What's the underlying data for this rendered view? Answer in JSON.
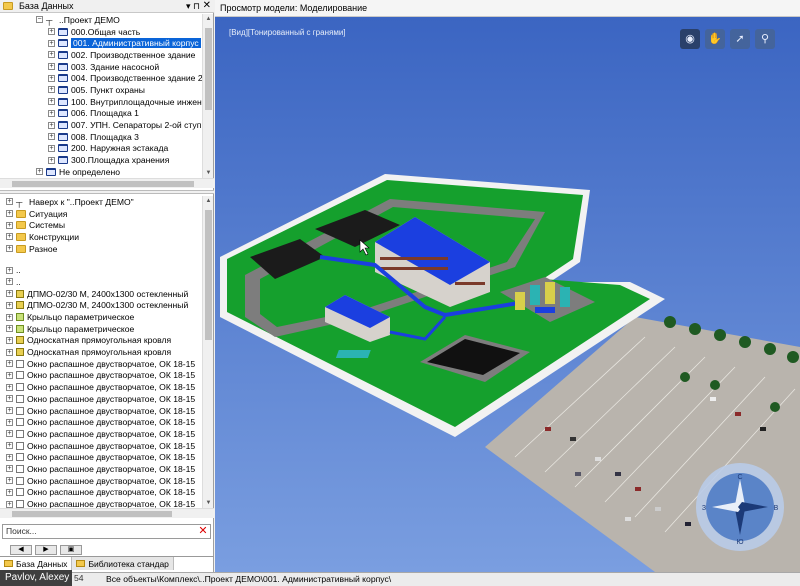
{
  "left_panel": {
    "title": "База Данных",
    "pin": "▾ ⊓",
    "close": "✕"
  },
  "top_tree": {
    "root": "..Проект ДЕМО",
    "items": [
      "000.Общая часть",
      "001. Административный корпус",
      "002. Производственное здание",
      "003. Здание насосной",
      "004. Производственное здание 2",
      "005. Пункт охраны",
      "100. Внутриплощадочные инжен",
      "006. Площадка 1",
      "007. УПН. Сепараторы 2-ой ступ",
      "008. Площадка 3",
      "200. Наружная эстакада",
      "300.Площадка хранения"
    ],
    "last": "Не определено"
  },
  "bottom_tree": {
    "up": "Наверх к \"..Проект ДЕМО\"",
    "folders": [
      "Ситуация",
      "Системы",
      "Конструкции",
      "Разное"
    ],
    "blank_rows": [
      "..",
      ".."
    ],
    "elements": [
      {
        "label": "ДПМО-02/30 М, 2400x1300 остекленный",
        "icon": "comp"
      },
      {
        "label": "ДПМО-02/30 М, 2400x1300 остекленный",
        "icon": "comp"
      },
      {
        "label": "Крыльцо параметрическое",
        "icon": "grn"
      },
      {
        "label": "Крыльцо параметрическое",
        "icon": "grn"
      },
      {
        "label": "Односкатная прямоугольная кровля",
        "icon": "comp"
      },
      {
        "label": "Односкатная прямоугольная кровля",
        "icon": "comp"
      },
      {
        "label": "Окно распашное двустворчатое, ОК 18-15",
        "icon": "win"
      },
      {
        "label": "Окно распашное двустворчатое, ОК 18-15",
        "icon": "win"
      },
      {
        "label": "Окно распашное двустворчатое, ОК 18-15",
        "icon": "win"
      },
      {
        "label": "Окно распашное двустворчатое, ОК 18-15",
        "icon": "win"
      },
      {
        "label": "Окно распашное двустворчатое, ОК 18-15",
        "icon": "win"
      },
      {
        "label": "Окно распашное двустворчатое, ОК 18-15",
        "icon": "win"
      },
      {
        "label": "Окно распашное двустворчатое, ОК 18-15",
        "icon": "win"
      },
      {
        "label": "Окно распашное двустворчатое, ОК 18-15",
        "icon": "win"
      },
      {
        "label": "Окно распашное двустворчатое, ОК 18-15",
        "icon": "win"
      },
      {
        "label": "Окно распашное двустворчатое, ОК 18-15",
        "icon": "win"
      },
      {
        "label": "Окно распашное двустворчатое, ОК 18-15",
        "icon": "win"
      },
      {
        "label": "Окно распашное двустворчатое, ОК 18-15",
        "icon": "win"
      },
      {
        "label": "Окно распашное двустворчатое, ОК 18-15",
        "icon": "win"
      }
    ]
  },
  "search": {
    "placeholder": "Поиск..."
  },
  "tabs": [
    {
      "label": "База Данных",
      "active": true
    },
    {
      "label": "Библиотека стандар",
      "active": false
    }
  ],
  "viewport": {
    "title": "Просмотр модели: Моделирование",
    "mode": "[Вид][Тонированный с гранями]",
    "tools": [
      {
        "name": "eye-icon",
        "glyph": "◉"
      },
      {
        "name": "hand-icon",
        "glyph": "✋"
      },
      {
        "name": "fly-icon",
        "glyph": "➚"
      },
      {
        "name": "walk-icon",
        "glyph": "⚲"
      }
    ],
    "compass_letters": [
      "С",
      "Ю",
      "З",
      "В"
    ]
  },
  "status": {
    "user": "Pavlov, Alexey",
    "count": "54",
    "path": "Все объекты\\Комплекс\\..Проект ДЕМО\\001. Административный корпус\\"
  },
  "colors": {
    "sky": "#5e86d4",
    "grass": "#14a02c",
    "building_roof": "#1b3fe0",
    "selection": "#0a64d8"
  }
}
